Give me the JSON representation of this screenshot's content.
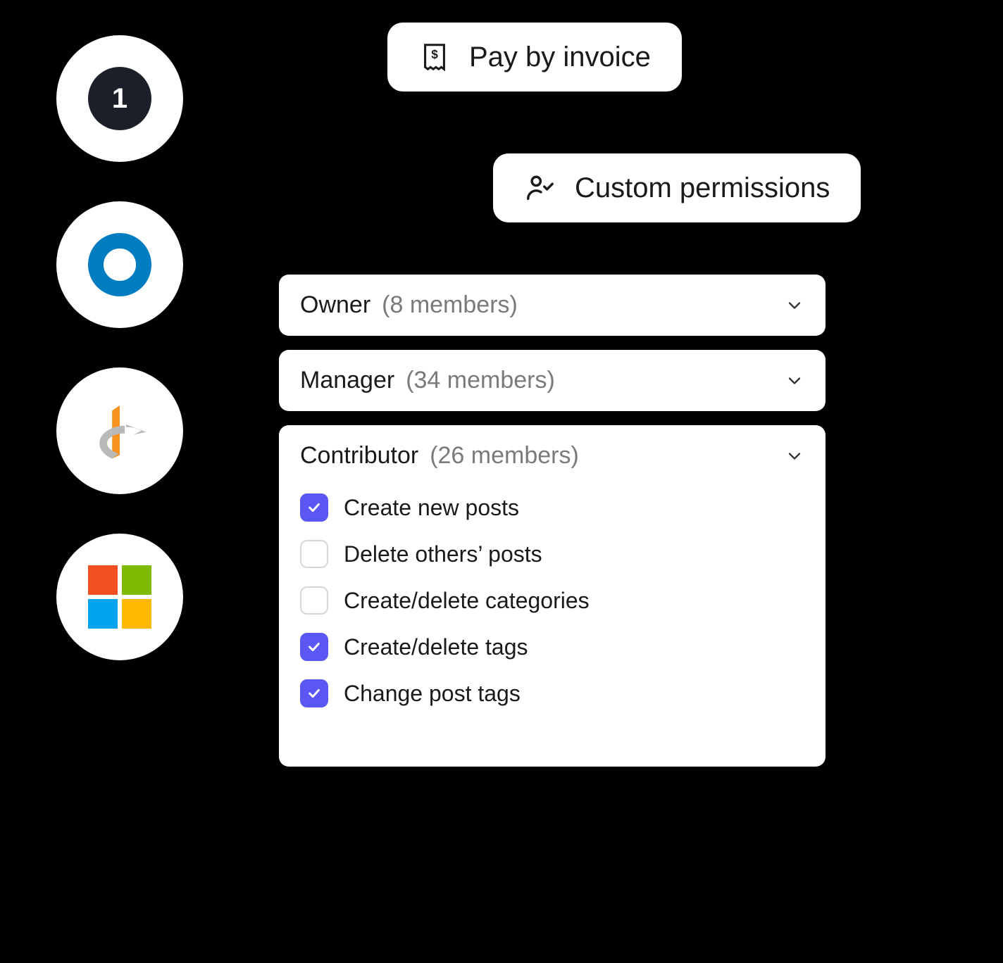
{
  "integrations": [
    {
      "name": "onepassword",
      "icon": "onepassword-icon"
    },
    {
      "name": "okta",
      "icon": "okta-icon"
    },
    {
      "name": "openid",
      "icon": "openid-icon"
    },
    {
      "name": "microsoft",
      "icon": "microsoft-icon"
    }
  ],
  "pills": {
    "invoice": {
      "label": "Pay by invoice"
    },
    "permissions": {
      "label": "Custom permissions"
    }
  },
  "roles": [
    {
      "name": "Owner",
      "count_label": "(8 members)",
      "expanded": false
    },
    {
      "name": "Manager",
      "count_label": "(34 members)",
      "expanded": false
    },
    {
      "name": "Contributor",
      "count_label": "(26 members)",
      "expanded": true,
      "permissions": [
        {
          "label": "Create new posts",
          "checked": true
        },
        {
          "label": "Delete others’ posts",
          "checked": false
        },
        {
          "label": "Create/delete categories",
          "checked": false
        },
        {
          "label": "Create/delete tags",
          "checked": true
        },
        {
          "label": "Change post tags",
          "checked": true
        }
      ]
    }
  ]
}
